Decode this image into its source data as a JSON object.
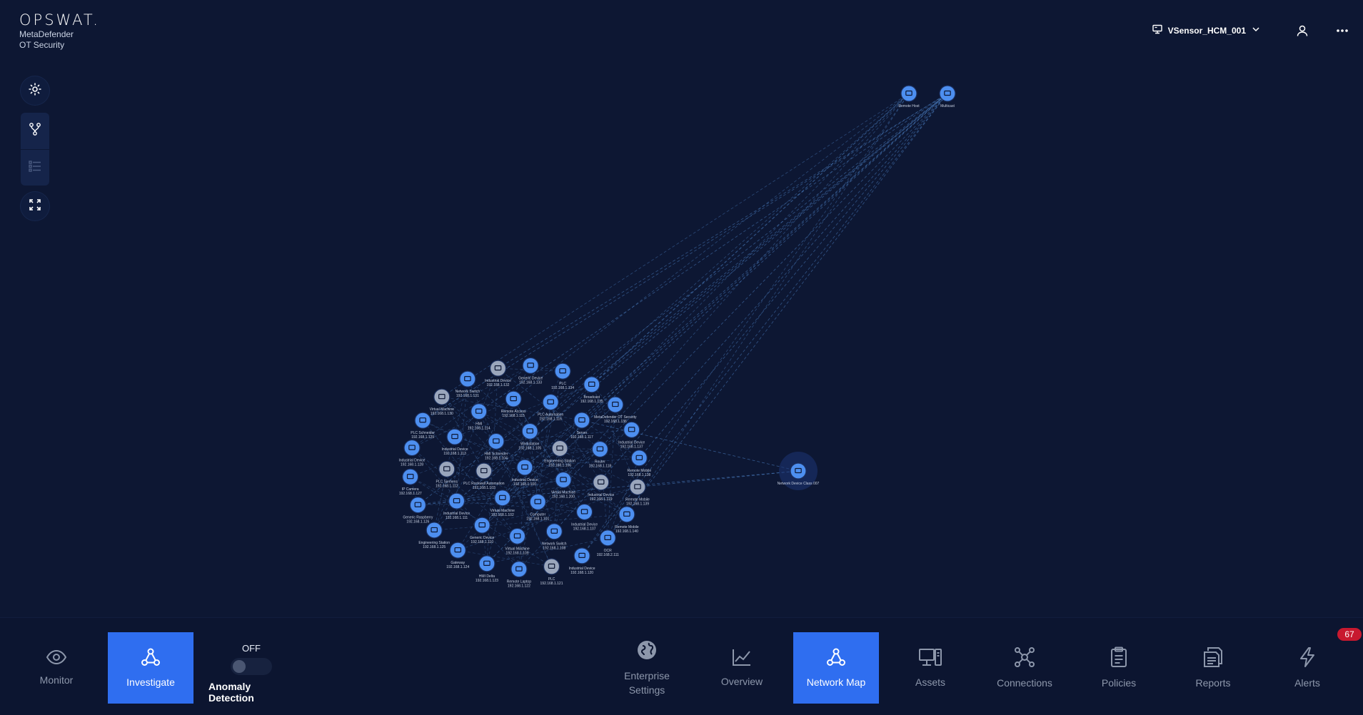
{
  "brand": {
    "logo": "OPSWAT.",
    "product_line1": "MetaDefender",
    "product_line2": "OT Security"
  },
  "header": {
    "sensor_name": "VSensor_HCM_001"
  },
  "left_tools": [
    {
      "name": "settings-icon"
    },
    {
      "name": "topology-icon"
    },
    {
      "name": "list-view-icon"
    },
    {
      "name": "fullscreen-icon"
    }
  ],
  "bottom_nav": {
    "left": [
      {
        "key": "monitor",
        "label": "Monitor",
        "icon": "eye-icon"
      },
      {
        "key": "investigate",
        "label": "Investigate",
        "icon": "network-icon",
        "active": true
      }
    ],
    "anomaly": {
      "state": "OFF",
      "label": "Anomaly Detection"
    },
    "right": [
      {
        "key": "enterprise",
        "line1": "Enterprise",
        "line2": "Settings",
        "icon": "globe-icon"
      },
      {
        "key": "overview",
        "label": "Overview",
        "icon": "chart-line-icon"
      },
      {
        "key": "network-map",
        "label": "Network Map",
        "icon": "network-icon",
        "active": true
      },
      {
        "key": "assets",
        "label": "Assets",
        "icon": "devices-icon"
      },
      {
        "key": "connections",
        "label": "Connections",
        "icon": "connections-icon"
      },
      {
        "key": "policies",
        "label": "Policies",
        "icon": "clipboard-icon"
      },
      {
        "key": "reports",
        "label": "Reports",
        "icon": "documents-icon"
      },
      {
        "key": "alerts",
        "label": "Alerts",
        "icon": "bolt-icon"
      }
    ],
    "alerts_count": "67"
  },
  "colors": {
    "background": "#0d1733",
    "accent": "#2f6ef0",
    "node": "#4d8ff0",
    "node_gray": "#9aa6bc",
    "edge": "#4f86cc",
    "badge": "#c8192f"
  },
  "network_map": {
    "top_nodes": [
      {
        "id": "t1",
        "label": "Remote Host"
      },
      {
        "id": "t2",
        "label": "Multicast"
      }
    ],
    "external_node": {
      "id": "ext",
      "label": "Network Device Class 007"
    },
    "cluster_nodes": [
      {
        "label": "Industrial Device",
        "ip": "192.168.1.100"
      },
      {
        "label": "Virtual Machine",
        "ip": "192.168.1.200"
      },
      {
        "label": "Computer",
        "ip": "192.168.1.101"
      },
      {
        "label": "Virtual Machine",
        "ip": "192.168.1.102"
      },
      {
        "label": "PLC Rockwell Automation",
        "ip": "192.168.1.103"
      },
      {
        "label": "HMI Schneider",
        "ip": "192.168.1.104"
      },
      {
        "label": "Workstation",
        "ip": "192.168.1.105"
      },
      {
        "label": "Engineering Station",
        "ip": "192.168.1.106"
      },
      {
        "label": "Industrial Device",
        "ip": "192.168.1.107"
      },
      {
        "label": "Network Switch",
        "ip": "192.168.1.108"
      },
      {
        "label": "Virtual Machine",
        "ip": "192.168.1.109"
      },
      {
        "label": "Generic Device",
        "ip": "192.168.1.110"
      },
      {
        "label": "Industrial Device",
        "ip": "192.168.1.111"
      },
      {
        "label": "PLC Siemens",
        "ip": "192.168.1.112"
      },
      {
        "label": "Industrial Device",
        "ip": "192.168.1.113"
      },
      {
        "label": "HMI",
        "ip": "192.168.1.114"
      },
      {
        "label": "Remote Access",
        "ip": "192.168.1.115"
      },
      {
        "label": "PLC Automation",
        "ip": "192.168.1.116"
      },
      {
        "label": "Server",
        "ip": "192.168.1.117"
      },
      {
        "label": "Router",
        "ip": "192.168.1.118"
      },
      {
        "label": "Industrial Device",
        "ip": "192.168.1.119"
      },
      {
        "label": "Industrial Device",
        "ip": "192.168.1.120"
      },
      {
        "label": "PLC",
        "ip": "192.168.1.121"
      },
      {
        "label": "Remote Laptop",
        "ip": "192.168.1.122"
      },
      {
        "label": "HMI Delta",
        "ip": "192.168.1.123"
      },
      {
        "label": "Gateway",
        "ip": "192.168.1.124"
      },
      {
        "label": "Engineering Station",
        "ip": "192.168.1.125"
      },
      {
        "label": "Generic Raspberry",
        "ip": "192.168.1.126"
      },
      {
        "label": "IP Camera",
        "ip": "192.168.1.127"
      },
      {
        "label": "Industrial Device",
        "ip": "192.168.1.128"
      },
      {
        "label": "PLC Schneider",
        "ip": "192.168.1.129"
      },
      {
        "label": "Virtual Machine",
        "ip": "192.168.1.130"
      },
      {
        "label": "Network Switch",
        "ip": "192.168.1.131"
      },
      {
        "label": "Industrial Device",
        "ip": "192.168.1.132"
      },
      {
        "label": "Generic Device",
        "ip": "192.168.1.133"
      },
      {
        "label": "PLC",
        "ip": "192.168.1.134"
      },
      {
        "label": "Broadcast",
        "ip": "192.168.1.135"
      },
      {
        "label": "MetaDefender OT Security",
        "ip": "192.168.1.136"
      },
      {
        "label": "Industrial Device",
        "ip": "192.168.1.137"
      },
      {
        "label": "Remote Mobile",
        "ip": "192.168.1.138"
      },
      {
        "label": "Remote Mobile",
        "ip": "192.168.1.139"
      },
      {
        "label": "Remote Mobile",
        "ip": "192.168.1.140"
      },
      {
        "label": "OCR",
        "ip": "192.168.2.111"
      }
    ]
  }
}
